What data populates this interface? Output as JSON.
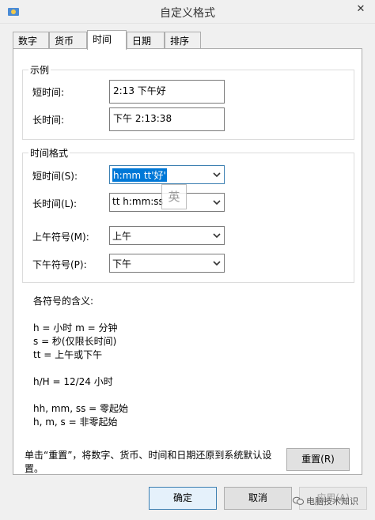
{
  "window": {
    "title": "自定义格式",
    "close_glyph": "✕"
  },
  "tabs": [
    {
      "label": "数字"
    },
    {
      "label": "货币"
    },
    {
      "label": "时间"
    },
    {
      "label": "日期"
    },
    {
      "label": "排序"
    }
  ],
  "example": {
    "title": "示例",
    "short_time_label": "短时间:",
    "short_time_value": "2:13 下午好",
    "long_time_label": "长时间:",
    "long_time_value": "下午 2:13:38"
  },
  "time_formats": {
    "title": "时间格式",
    "short_time_label": "短时间(S):",
    "short_time_value": "h:mm tt'好'",
    "long_time_label": "长时间(L):",
    "long_time_value": "tt h:mm:ss",
    "am_label": "上午符号(M):",
    "am_value": "上午",
    "pm_label": "下午符号(P):",
    "pm_value": "下午"
  },
  "ime_indicator": "英",
  "help": {
    "heading": "各符号的含义:",
    "line1": "h = 小时   m = 分钟",
    "line2": "s = 秒(仅限长时间)",
    "line3": "tt = 上午或下午",
    "line4": "h/H = 12/24 小时",
    "line5": "hh, mm, ss = 零起始",
    "line6": "h, m, s = 非零起始"
  },
  "reset": {
    "text_line1": "单击“重置”，将数字、货币、时间和日期还原到系统默认设",
    "text_line2": "置。",
    "button_label": "重置(R)"
  },
  "footer": {
    "ok_label": "确定",
    "cancel_label": "取消",
    "apply_label": "应用(A)"
  },
  "watermark": "电脑技术知识",
  "colors": {
    "selection": "#0078d7",
    "focus_border": "#3c7fb1"
  }
}
